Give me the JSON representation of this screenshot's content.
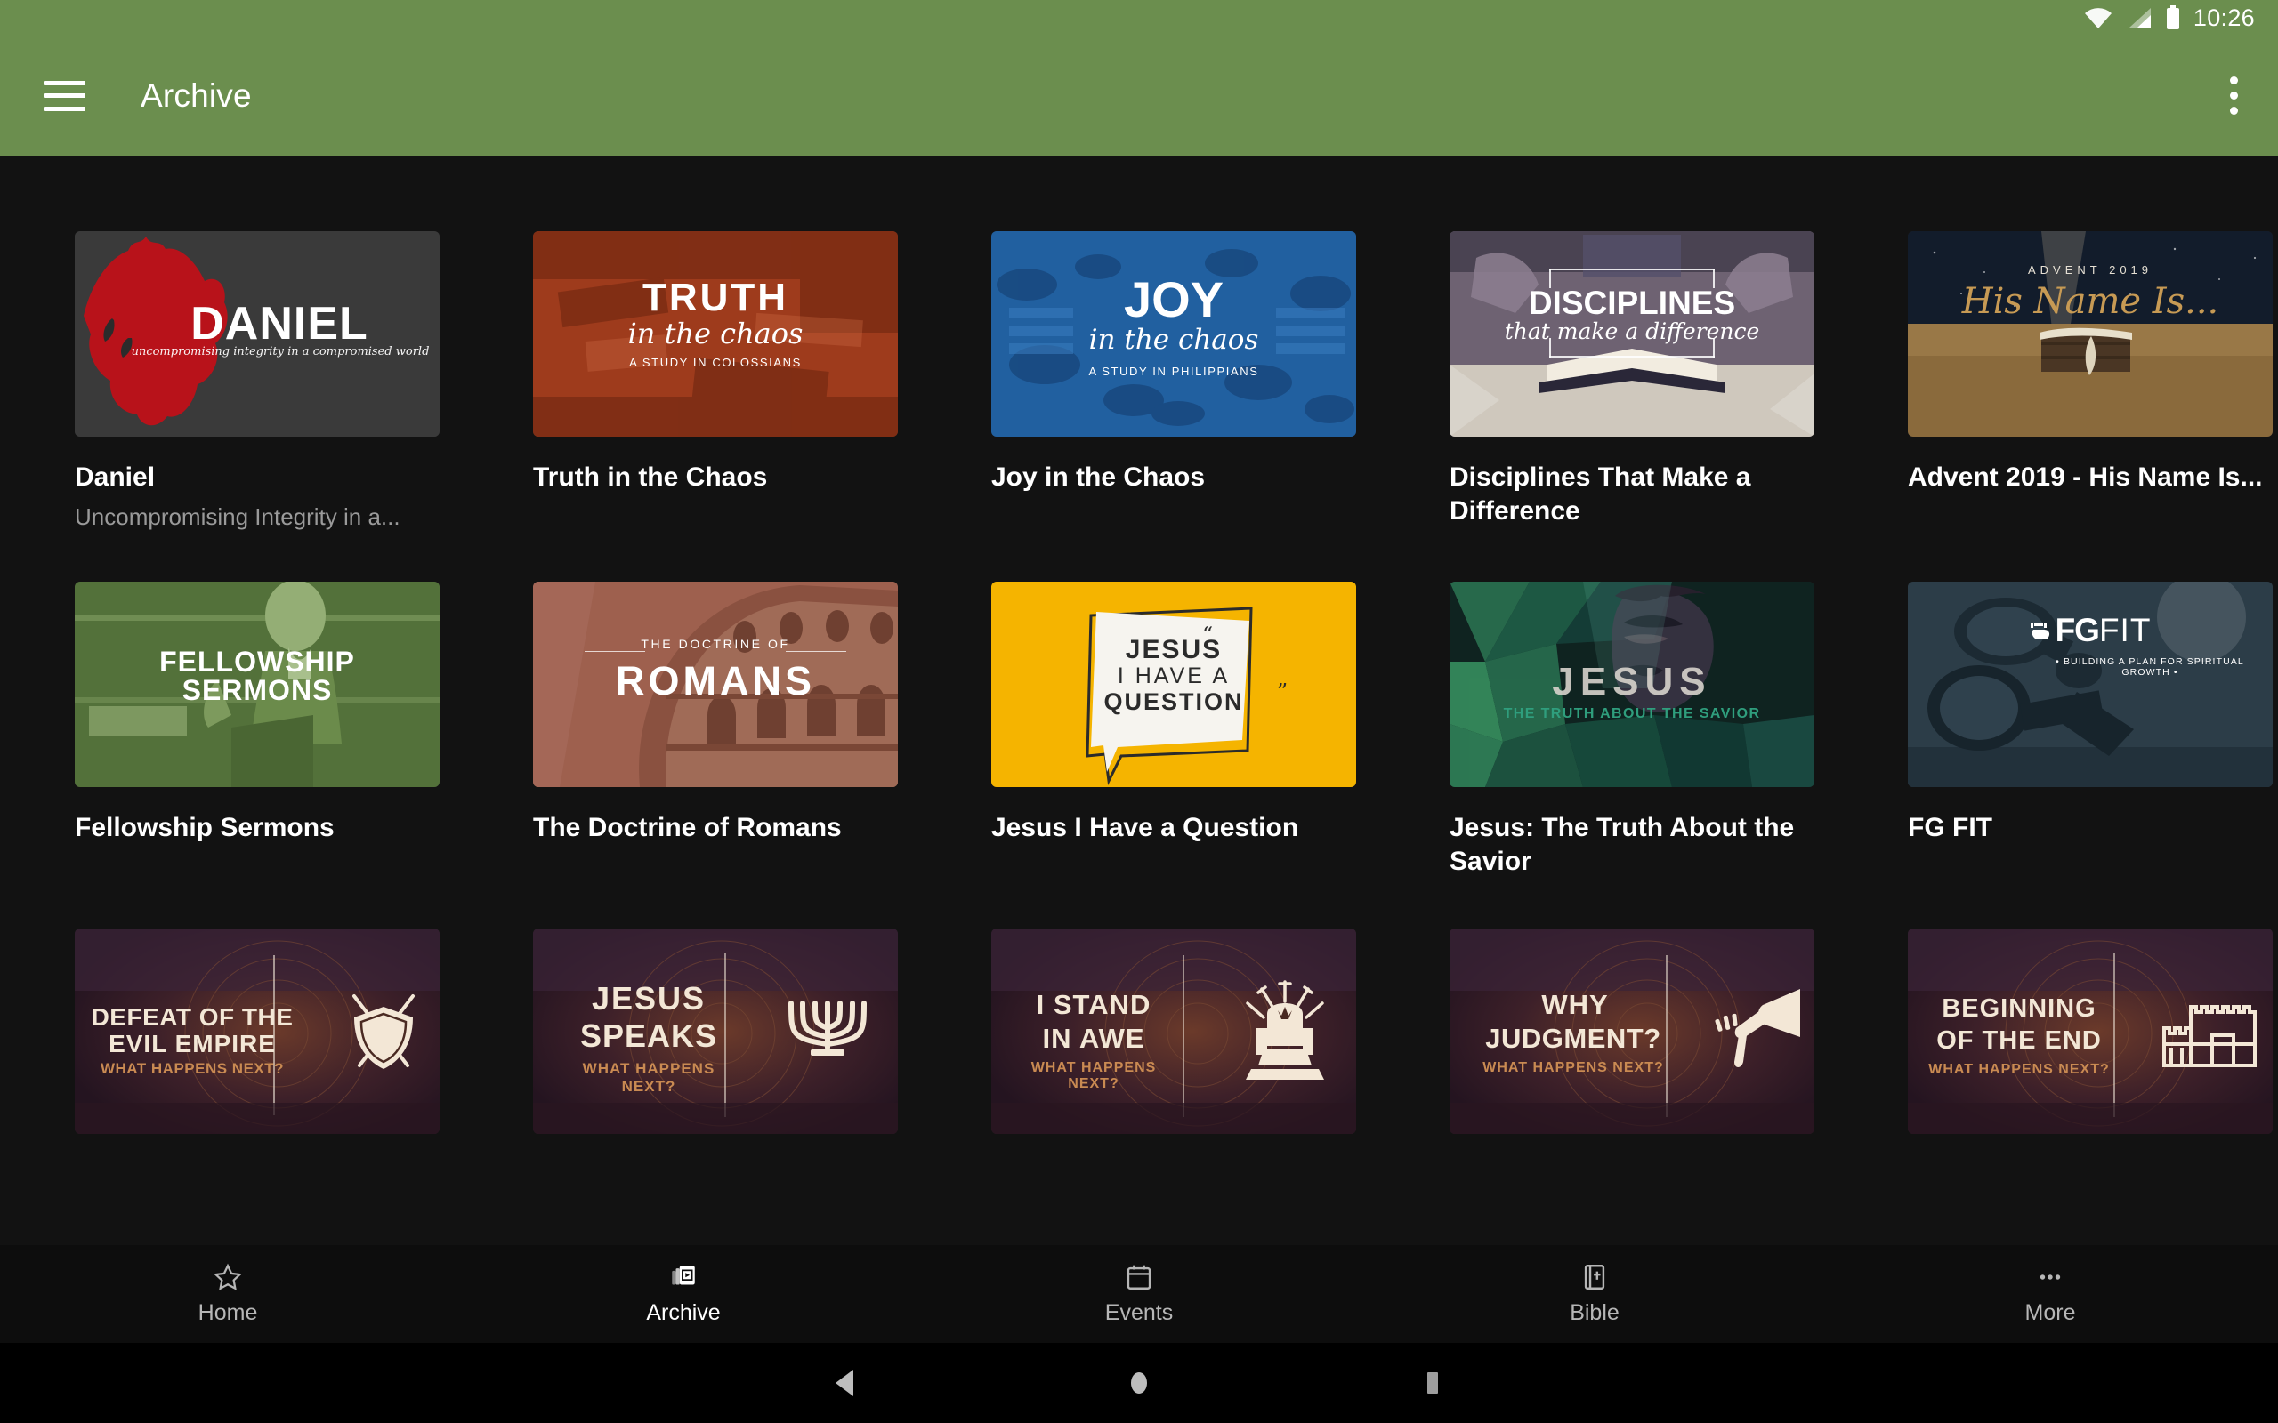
{
  "status_bar": {
    "time": "10:26",
    "icons": [
      "wifi-icon",
      "cell-signal-icon",
      "battery-icon"
    ]
  },
  "app_bar": {
    "menu_icon": "hamburger-menu-icon",
    "title": "Archive",
    "overflow_icon": "overflow-menu-icon"
  },
  "colors": {
    "app_bar_green": "#6b8e4e",
    "page_background": "#121212",
    "nav_background": "#0d0d0d",
    "title_text": "#ffffff",
    "subtitle_text": "#9a9a9a",
    "nav_inactive": "#b6b6b6",
    "nav_active": "#ffffff"
  },
  "series": [
    {
      "title": "Daniel",
      "subtitle": "Uncompromising Integrity in a...",
      "art": {
        "id": "daniel-art",
        "main": "DANIEL",
        "script": "uncompromising integrity in a compromised world",
        "bg": "#3a3a3a",
        "accent": "#b8121a"
      }
    },
    {
      "title": "Truth in the Chaos",
      "subtitle": "",
      "art": {
        "id": "truth-art",
        "main": "TRUTH",
        "script": "in the chaos",
        "tagline": "A STUDY IN COLOSSIANS",
        "bg": "#9e3b1c",
        "accent": "#5d1f0d"
      }
    },
    {
      "title": "Joy in the Chaos",
      "subtitle": "",
      "art": {
        "id": "joy-art",
        "main": "JOY",
        "script": "in the chaos",
        "tagline": "A STUDY IN PHILIPPIANS",
        "bg": "#2160a0",
        "accent": "#17457a"
      }
    },
    {
      "title": "Disciplines That Make a Difference",
      "subtitle": "",
      "art": {
        "id": "disciplines-art",
        "main": "DISCIPLINES",
        "script": "that make a difference",
        "bg": "#6e6272",
        "accent": "#cfc8bd"
      }
    },
    {
      "title": "Advent 2019 - His Name Is...",
      "subtitle": "",
      "art": {
        "id": "advent-art",
        "kicker": "ADVENT 2019",
        "script": "His Name Is...",
        "bg": "#121c2b",
        "accent": "#c79a54"
      }
    },
    {
      "title": "Fellowship Sermons",
      "subtitle": "",
      "art": {
        "id": "fellowship-art",
        "main_line1": "FELLOWSHIP",
        "main_line2": "SERMONS",
        "bg": "#53713a",
        "accent": "#7e9a5e"
      }
    },
    {
      "title": "The Doctrine of Romans",
      "subtitle": "",
      "art": {
        "id": "romans-art",
        "kicker": "THE DOCTRINE OF",
        "main": "ROMANS",
        "bg": "#9e604e",
        "accent": "#7d4839"
      }
    },
    {
      "title": "Jesus I Have a Question",
      "subtitle": "",
      "art": {
        "id": "question-art",
        "line1": "JESUS",
        "line2": "I HAVE A",
        "line3": "QUESTION",
        "bg": "#f5b400",
        "accent": "#2b2b2b"
      }
    },
    {
      "title": "Jesus: The Truth About the Savior",
      "subtitle": "",
      "art": {
        "id": "savior-art",
        "main": "JESUS",
        "tagline": "THE TRUTH ABOUT THE SAVIOR",
        "bg": "#16322d",
        "accent": "#2f9e7d"
      }
    },
    {
      "title": "FG FIT",
      "subtitle": "",
      "art": {
        "id": "fgfit-art",
        "main_bold": "FG",
        "main_light": "FIT",
        "tagline": "• BUILDING A PLAN FOR SPIRITUAL GROWTH •",
        "bg": "#2c3d48",
        "accent": "#f2f2f2"
      }
    },
    {
      "title": "",
      "subtitle": "",
      "art": {
        "id": "evil-empire-art",
        "line1": "DEFEAT OF THE",
        "line2": "EVIL EMPIRE",
        "tagline": "WHAT HAPPENS NEXT?",
        "icon": "shield-and-swords-icon",
        "bg": "#2a1a24",
        "accent": "#f3e7d6",
        "tagline_color": "#c98a52"
      }
    },
    {
      "title": "",
      "subtitle": "",
      "art": {
        "id": "jesus-speaks-art",
        "line1": "JESUS",
        "line2": "SPEAKS",
        "tagline": "WHAT HAPPENS NEXT?",
        "icon": "menorah-icon",
        "bg": "#2a1a24",
        "accent": "#f3e7d6",
        "tagline_color": "#c98a52"
      }
    },
    {
      "title": "",
      "subtitle": "",
      "art": {
        "id": "stand-in-awe-art",
        "line1": "I STAND",
        "line2": "IN AWE",
        "tagline": "WHAT HAPPENS NEXT?",
        "icon": "throne-icon",
        "bg": "#2a1a24",
        "accent": "#f3e7d6",
        "tagline_color": "#c98a52"
      }
    },
    {
      "title": "",
      "subtitle": "",
      "art": {
        "id": "why-judgment-art",
        "line1": "WHY",
        "line2": "JUDGMENT?",
        "tagline": "WHAT HAPPENS NEXT?",
        "icon": "trumpet-icon",
        "bg": "#2a1a24",
        "accent": "#f3e7d6",
        "tagline_color": "#c98a52"
      }
    },
    {
      "title": "",
      "subtitle": "",
      "art": {
        "id": "beginning-of-end-art",
        "line1": "BEGINNING",
        "line2": "OF THE END",
        "tagline": "WHAT HAPPENS NEXT?",
        "icon": "temple-icon",
        "bg": "#2a1a24",
        "accent": "#f3e7d6",
        "tagline_color": "#c98a52"
      }
    }
  ],
  "bottom_nav": {
    "items": [
      {
        "label": "Home",
        "icon": "star-outline-icon",
        "active": false
      },
      {
        "label": "Archive",
        "icon": "video-library-icon",
        "active": true
      },
      {
        "label": "Events",
        "icon": "calendar-icon",
        "active": false
      },
      {
        "label": "Bible",
        "icon": "bible-book-icon",
        "active": false
      },
      {
        "label": "More",
        "icon": "more-dots-icon",
        "active": false
      }
    ]
  },
  "system_bar": {
    "back": "back-triangle-icon",
    "home": "home-circle-icon",
    "recents": "recents-square-icon"
  }
}
